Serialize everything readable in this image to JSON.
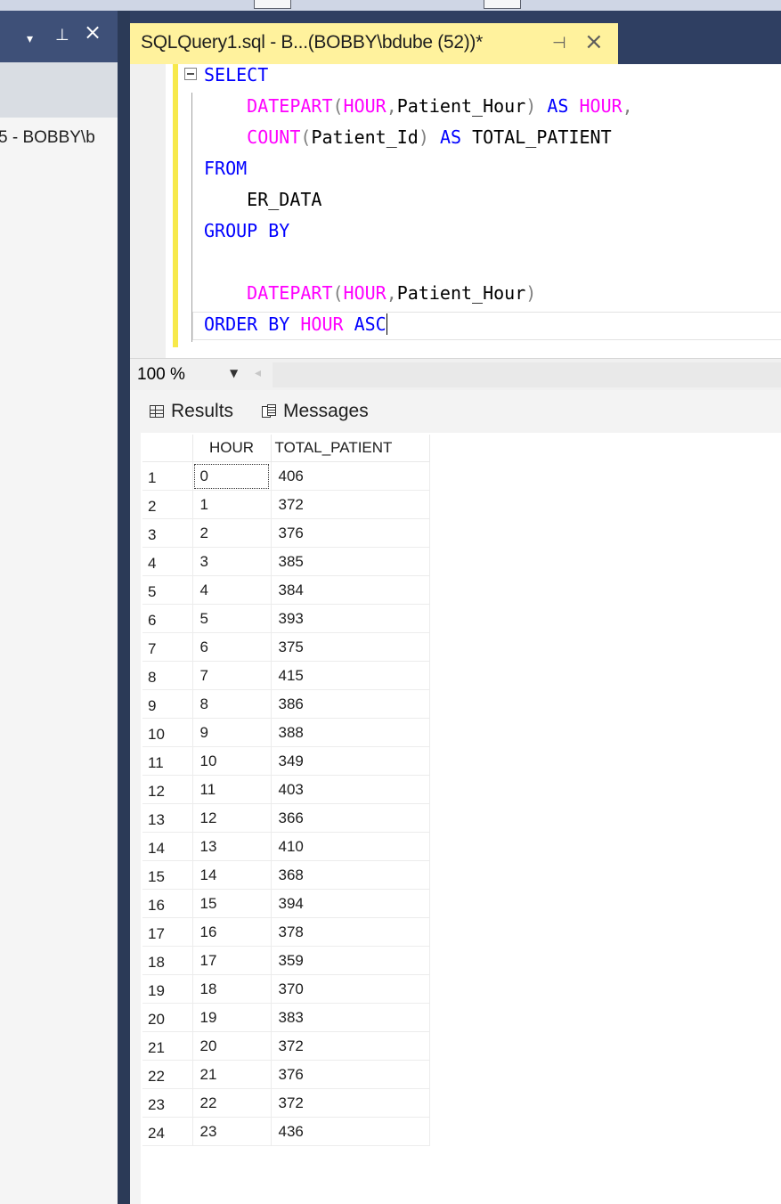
{
  "left_panel": {
    "header_controls": [
      "▾",
      "🖈",
      "×"
    ],
    "server_node": "5 - BOBBY\\b"
  },
  "document_tab": {
    "title": "SQLQuery1.sql - B...(BOBBY\\bdube (52))*"
  },
  "editor": {
    "lines": [
      [
        {
          "t": "SELECT",
          "c": "kw"
        }
      ],
      [
        {
          "t": "    "
        },
        {
          "t": "DATEPART",
          "c": "fn"
        },
        {
          "t": "(",
          "c": "gr"
        },
        {
          "t": "HOUR",
          "c": "fn"
        },
        {
          "t": ",",
          "c": "gr"
        },
        {
          "t": "Patient_Hour",
          "c": "pl"
        },
        {
          "t": ")",
          "c": "gr"
        },
        {
          "t": " AS ",
          "c": "kw"
        },
        {
          "t": "HOUR",
          "c": "fn"
        },
        {
          "t": ",",
          "c": "gr"
        }
      ],
      [
        {
          "t": "    "
        },
        {
          "t": "COUNT",
          "c": "fn"
        },
        {
          "t": "(",
          "c": "gr"
        },
        {
          "t": "Patient_Id",
          "c": "pl"
        },
        {
          "t": ")",
          "c": "gr"
        },
        {
          "t": " AS ",
          "c": "kw"
        },
        {
          "t": "TOTAL_PATIENT",
          "c": "pl"
        }
      ],
      [
        {
          "t": "FROM",
          "c": "kw"
        }
      ],
      [
        {
          "t": "    "
        },
        {
          "t": "ER_DATA",
          "c": "pl"
        }
      ],
      [
        {
          "t": "GROUP BY",
          "c": "kw"
        }
      ],
      [],
      [
        {
          "t": "    "
        },
        {
          "t": "DATEPART",
          "c": "fn"
        },
        {
          "t": "(",
          "c": "gr"
        },
        {
          "t": "HOUR",
          "c": "fn"
        },
        {
          "t": ",",
          "c": "gr"
        },
        {
          "t": "Patient_Hour",
          "c": "pl"
        },
        {
          "t": ")",
          "c": "gr"
        }
      ],
      [
        {
          "t": "ORDER BY ",
          "c": "kw"
        },
        {
          "t": "HOUR",
          "c": "fn"
        },
        {
          "t": " ASC",
          "c": "kw"
        }
      ]
    ]
  },
  "zoom": {
    "value": "100 %"
  },
  "results_tabs": {
    "results_label": "Results",
    "messages_label": "Messages"
  },
  "grid": {
    "columns": [
      "",
      "HOUR",
      "TOTAL_PATIENT"
    ],
    "rows": [
      [
        "1",
        "0",
        "406"
      ],
      [
        "2",
        "1",
        "372"
      ],
      [
        "3",
        "2",
        "376"
      ],
      [
        "4",
        "3",
        "385"
      ],
      [
        "5",
        "4",
        "384"
      ],
      [
        "6",
        "5",
        "393"
      ],
      [
        "7",
        "6",
        "375"
      ],
      [
        "8",
        "7",
        "415"
      ],
      [
        "9",
        "8",
        "386"
      ],
      [
        "10",
        "9",
        "388"
      ],
      [
        "11",
        "10",
        "349"
      ],
      [
        "12",
        "11",
        "403"
      ],
      [
        "13",
        "12",
        "366"
      ],
      [
        "14",
        "13",
        "410"
      ],
      [
        "15",
        "14",
        "368"
      ],
      [
        "16",
        "15",
        "394"
      ],
      [
        "17",
        "16",
        "378"
      ],
      [
        "18",
        "17",
        "359"
      ],
      [
        "19",
        "18",
        "370"
      ],
      [
        "20",
        "19",
        "383"
      ],
      [
        "21",
        "20",
        "372"
      ],
      [
        "22",
        "21",
        "376"
      ],
      [
        "23",
        "22",
        "372"
      ],
      [
        "24",
        "23",
        "436"
      ]
    ]
  }
}
